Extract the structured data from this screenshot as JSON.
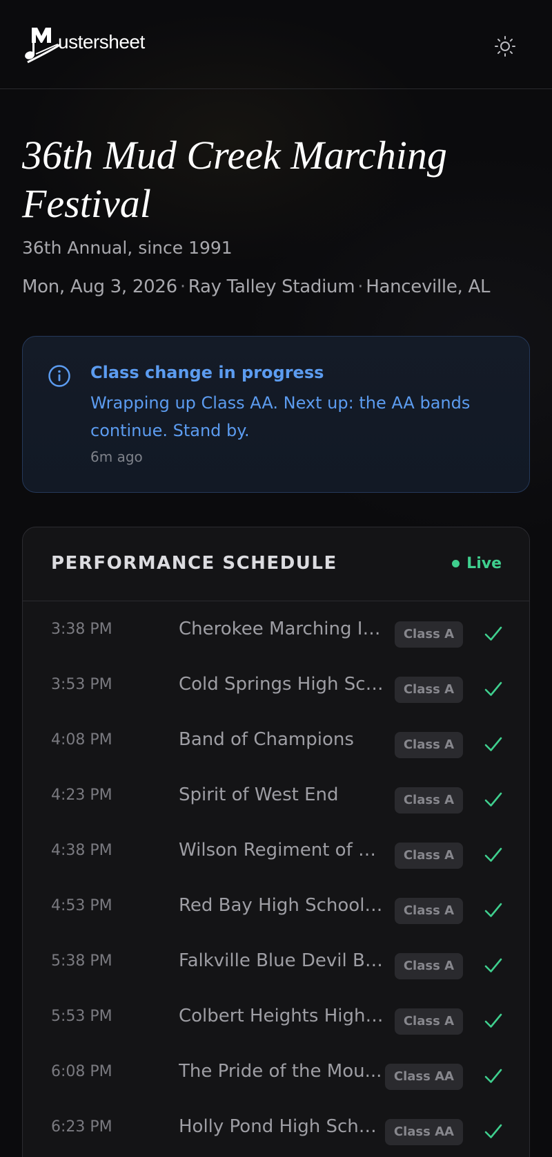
{
  "app": {
    "logo_text": "MusterSheet",
    "logo_accessible_letters": "ustersheet"
  },
  "event": {
    "title": "36th Mud Creek Marching Festival",
    "subtitle": "36th Annual, since 1991",
    "date": "Mon, Aug 3, 2026",
    "venue": "Ray Talley Stadium",
    "location": "Hanceville, AL",
    "separator": "·"
  },
  "alert": {
    "icon": "info-icon",
    "title": "Class change in progress",
    "body": "Wrapping up Class AA. Next up: the AA bands continue. Stand by.",
    "time": "6m ago",
    "color": "#5c9cf0"
  },
  "schedule": {
    "title": "PERFORMANCE SCHEDULE",
    "status": "Live",
    "status_color": "#3fcf8e",
    "rows": [
      {
        "time": "3:38 PM",
        "band": "Cherokee Marching In...",
        "class": "Class A",
        "done": true
      },
      {
        "time": "3:53 PM",
        "band": "Cold Springs High Sch...",
        "class": "Class A",
        "done": true
      },
      {
        "time": "4:08 PM",
        "band": "Band of Champions",
        "class": "Class A",
        "done": true
      },
      {
        "time": "4:23 PM",
        "band": "Spirit of West End",
        "class": "Class A",
        "done": true
      },
      {
        "time": "4:38 PM",
        "band": "Wilson Regiment of Bl...",
        "class": "Class A",
        "done": true
      },
      {
        "time": "4:53 PM",
        "band": "Red Bay High School B...",
        "class": "Class A",
        "done": true
      },
      {
        "time": "5:38 PM",
        "band": "Falkville Blue Devil Band",
        "class": "Class A",
        "done": true
      },
      {
        "time": "5:53 PM",
        "band": "Colbert Heights High ...",
        "class": "Class A",
        "done": true
      },
      {
        "time": "6:08 PM",
        "band": "The Pride of the Mou...",
        "class": "Class AA",
        "done": true
      },
      {
        "time": "6:23 PM",
        "band": "Holly Pond High Scho...",
        "class": "Class AA",
        "done": true
      }
    ]
  }
}
